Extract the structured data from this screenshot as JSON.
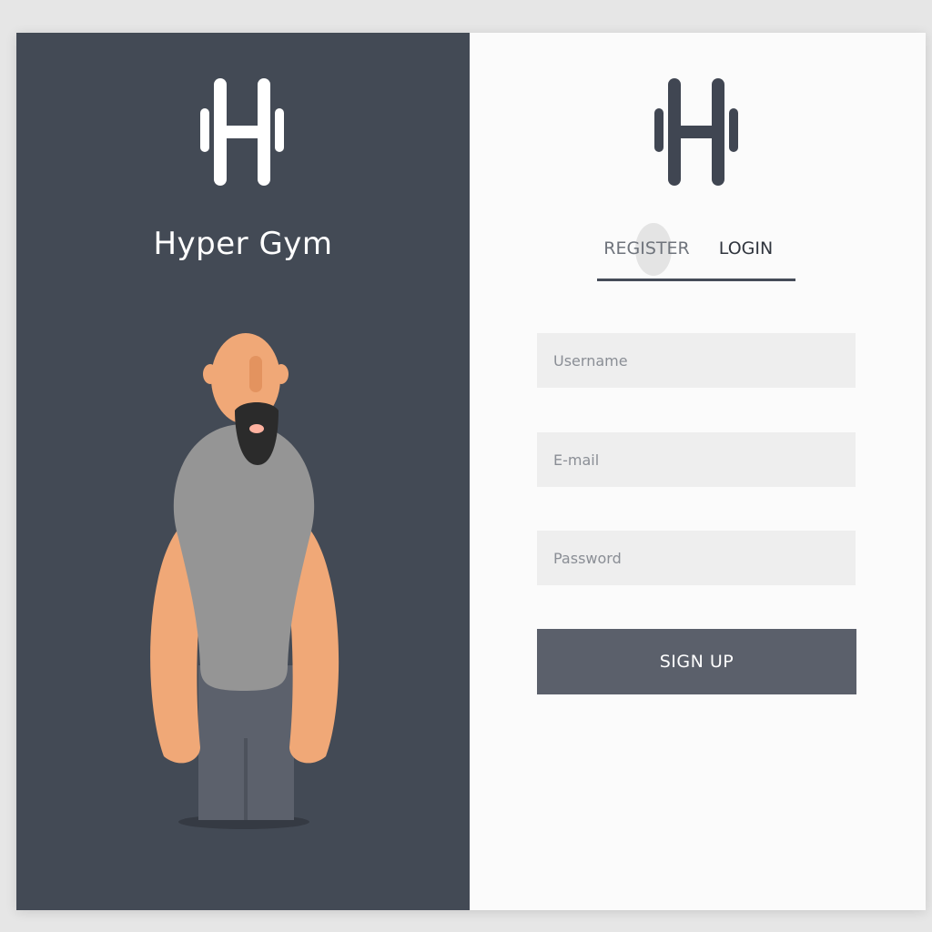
{
  "brand": {
    "name": "Hyper Gym",
    "logo_icon": "dumbbell-h-icon"
  },
  "colors": {
    "left_panel": "#434a55",
    "right_panel": "#fbfbfb",
    "button": "#5b606b",
    "field": "#eeeeee",
    "skin": "#f0a877"
  },
  "tabs": {
    "register": "REGISTER",
    "login": "LOGIN"
  },
  "form": {
    "username_placeholder": "Username",
    "email_placeholder": "E-mail",
    "password_placeholder": "Password",
    "submit_label": "SIGN UP"
  }
}
